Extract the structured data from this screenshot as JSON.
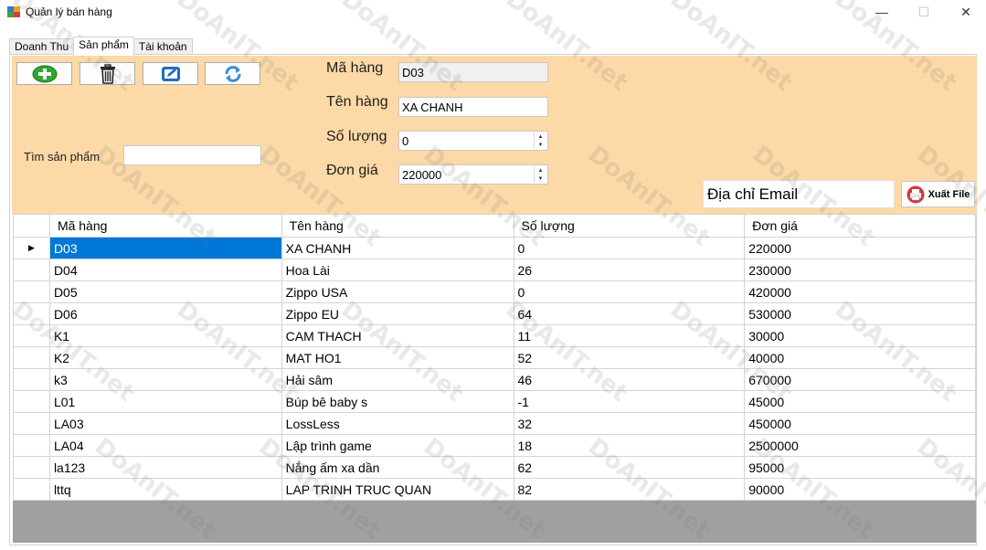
{
  "window": {
    "title": "Quản lý bán hàng",
    "minimize_glyph": "—",
    "maximize_glyph": "☐",
    "close_glyph": "✕"
  },
  "tabs": [
    {
      "label": "Doanh Thu",
      "active": false
    },
    {
      "label": "Sản phẩm",
      "active": true
    },
    {
      "label": "Tài khoản",
      "active": false
    }
  ],
  "toolbar": {
    "buttons": [
      "add-icon",
      "delete-icon",
      "edit-icon",
      "refresh-icon"
    ]
  },
  "search": {
    "label": "Tìm sản phẩm",
    "value": ""
  },
  "form": {
    "ma_hang_label": "Mã hàng",
    "ma_hang_value": "D03",
    "ten_hang_label": "Tên hàng",
    "ten_hang_value": "XA CHANH",
    "so_luong_label": "Số lượng",
    "so_luong_value": "0",
    "don_gia_label": "Đơn giá",
    "don_gia_value": "220000"
  },
  "email": {
    "value": "Địa chỉ Email"
  },
  "export": {
    "label": "Xuất File"
  },
  "grid": {
    "columns": [
      "Mã hàng",
      "Tên hàng",
      "Số lượng",
      "Đơn giá"
    ],
    "selected_row": 0,
    "rows": [
      [
        "D03",
        "XA CHANH",
        "0",
        "220000"
      ],
      [
        "D04",
        "Hoa Lài",
        "26",
        "230000"
      ],
      [
        "D05",
        "Zippo USA",
        "0",
        "420000"
      ],
      [
        "D06",
        "Zippo EU",
        "64",
        "530000"
      ],
      [
        "K1",
        "CAM THACH",
        "11",
        "30000"
      ],
      [
        "K2",
        "MAT HO1",
        "52",
        "40000"
      ],
      [
        "k3",
        "Hải sâm",
        "46",
        "670000"
      ],
      [
        "L01",
        "Búp bê baby s",
        "-1",
        "45000"
      ],
      [
        "LA03",
        "LossLess",
        "32",
        "450000"
      ],
      [
        "LA04",
        "Lập trình game",
        "18",
        "2500000"
      ],
      [
        "la123",
        "Nắng ấm xa dần",
        "62",
        "95000"
      ],
      [
        "lttq",
        "LAP TRINH TRUC QUAN",
        "82",
        "90000"
      ]
    ]
  },
  "watermark": "DoAnIT.net",
  "colors": {
    "panel": "#fcd9a6",
    "selection": "#0078d7",
    "grid_empty": "#a0a0a0"
  }
}
